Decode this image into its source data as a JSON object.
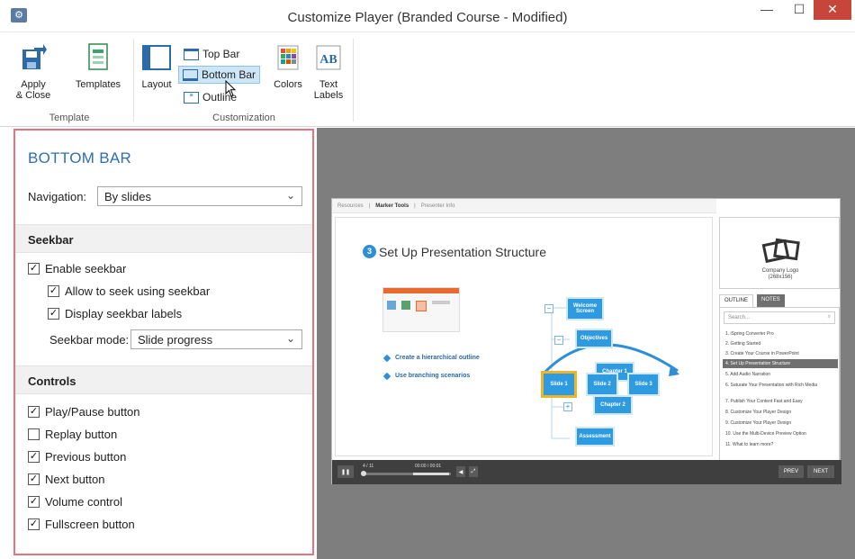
{
  "window": {
    "title": "Customize Player (Branded Course - Modified)",
    "controls": [
      "minimize",
      "maximize",
      "close"
    ]
  },
  "ribbon": {
    "template_group": {
      "label": "Template",
      "buttons": [
        {
          "label_line1": "Apply",
          "label_line2": "& Close",
          "icon": "save-close-icon"
        },
        {
          "label_line1": "Templates",
          "icon": "templates-icon"
        }
      ]
    },
    "customization_group": {
      "label": "Customization",
      "layout_label": "Layout",
      "top_bar_label": "Top Bar",
      "bottom_bar_label": "Bottom Bar",
      "outline_label": "Outline",
      "colors_label": "Colors",
      "text_labels_line1": "Text",
      "text_labels_line2": "Labels",
      "selected": "Bottom Bar"
    }
  },
  "panel": {
    "heading": "BOTTOM BAR",
    "navigation": {
      "label": "Navigation:",
      "value": "By slides"
    },
    "seekbar_section": {
      "title": "Seekbar",
      "enable_seekbar": {
        "label": "Enable seekbar",
        "checked": true
      },
      "allow_seek": {
        "label": "Allow to seek using seekbar",
        "checked": true
      },
      "display_labels": {
        "label": "Display seekbar labels",
        "checked": true
      },
      "mode": {
        "label": "Seekbar mode:",
        "value": "Slide progress"
      }
    },
    "controls_section": {
      "title": "Controls",
      "items": [
        {
          "label": "Play/Pause button",
          "checked": true
        },
        {
          "label": "Replay button",
          "checked": false
        },
        {
          "label": "Previous button",
          "checked": true
        },
        {
          "label": "Next button",
          "checked": true
        },
        {
          "label": "Volume control",
          "checked": true
        },
        {
          "label": "Fullscreen button",
          "checked": true
        }
      ]
    }
  },
  "preview": {
    "top_tabs": [
      "Resources",
      "Marker Tools",
      "Presenter Info"
    ],
    "slide": {
      "number": "3",
      "title": "Set Up Presentation Structure",
      "bullets": [
        "Create a hierarchical outline",
        "Use branching scenarios"
      ],
      "diagram": {
        "welcome": "Welcome Screen",
        "objectives": "Objectives",
        "slide1": "Slide 1",
        "slide2": "Slide 2",
        "slide3": "Slide 3",
        "chapter1": "Chapter 1",
        "chapter2": "Chapter 2",
        "assessment": "Assessment"
      }
    },
    "logo": {
      "line1": "Company Logo",
      "line2": "(268x156)"
    },
    "tabs": {
      "outline": "OUTLINE",
      "notes": "NOTES"
    },
    "search_placeholder": "Search...",
    "outline_items": [
      "1. iSpring Converter Pro",
      "2. Getting Started",
      "3. Create Your Course in PowerPoint",
      "4. Set Up Presentation Structure",
      "5. Add Audio Narration",
      "6. Saturate Your Presentation with Rich Media",
      "7. Publish Your Content Fast and Easy",
      "8. Customize Your Player Design",
      "9. Customize Your Player Design",
      "10. Use the Multi-Device Preview Option",
      "11. What to learn more?"
    ],
    "current_outline_index": 3,
    "player_bar": {
      "slide_counter": "4 / 11",
      "time": "00:00 / 00:01",
      "prev_label": "PREV",
      "next_label": "NEXT"
    }
  }
}
